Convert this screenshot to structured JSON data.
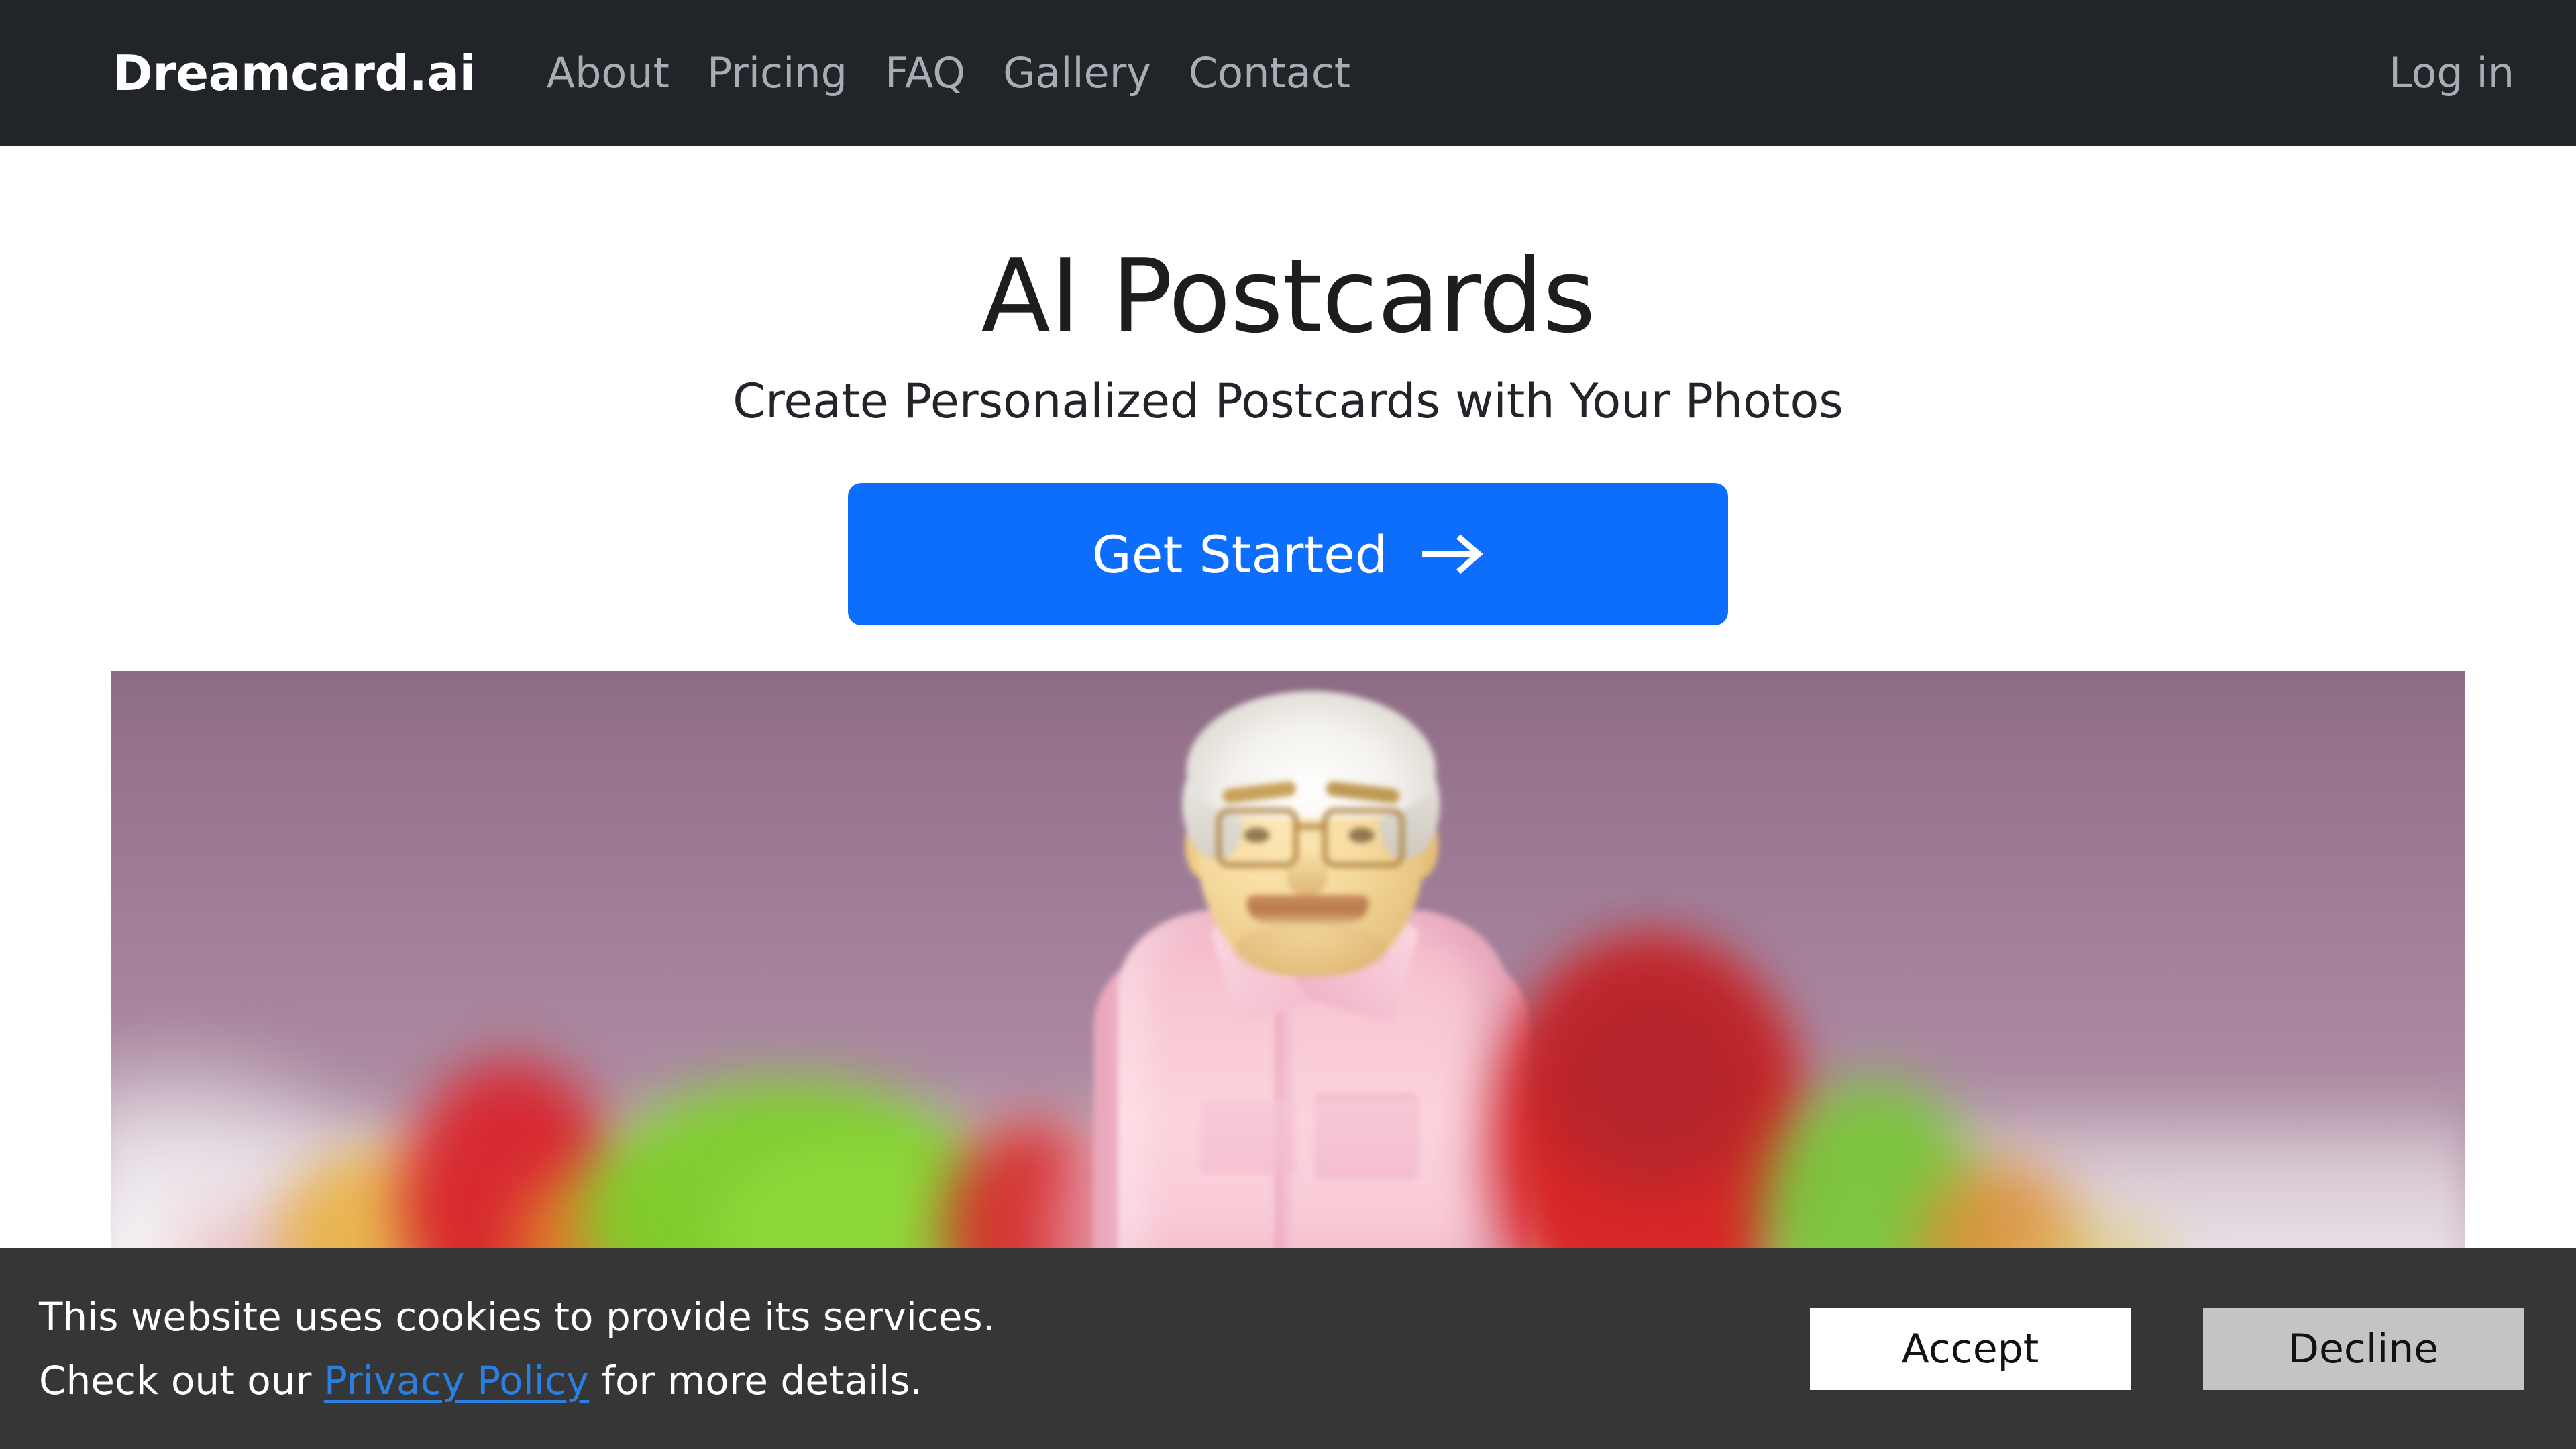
{
  "navbar": {
    "brand": "Dreamcard.ai",
    "links": [
      {
        "label": "About"
      },
      {
        "label": "Pricing"
      },
      {
        "label": "FAQ"
      },
      {
        "label": "Gallery"
      },
      {
        "label": "Contact"
      }
    ],
    "login_label": "Log in",
    "background_color": "#212529",
    "link_color": "#a8adb3",
    "brand_color": "#ffffff"
  },
  "hero": {
    "title": "AI Postcards",
    "subtitle": "Create Personalized Postcards with Your Photos",
    "cta_label": "Get Started",
    "cta_icon": "arrow-right-icon",
    "cta_color": "#0d6efd",
    "image_alt": "Blurred photo of a smiling figurine in a pink shirt against a mauve backdrop with colorful fruit in the foreground"
  },
  "cookie_banner": {
    "line1": "This website uses cookies to provide its services.",
    "line2_before": "Check out our ",
    "link_label": "Privacy Policy",
    "line2_after": " for more details.",
    "accept_label": "Accept",
    "decline_label": "Decline",
    "background_color": "#363636",
    "link_color": "#2a7fe0",
    "accept_color": "#ffffff",
    "decline_color": "#c4c4c4"
  }
}
